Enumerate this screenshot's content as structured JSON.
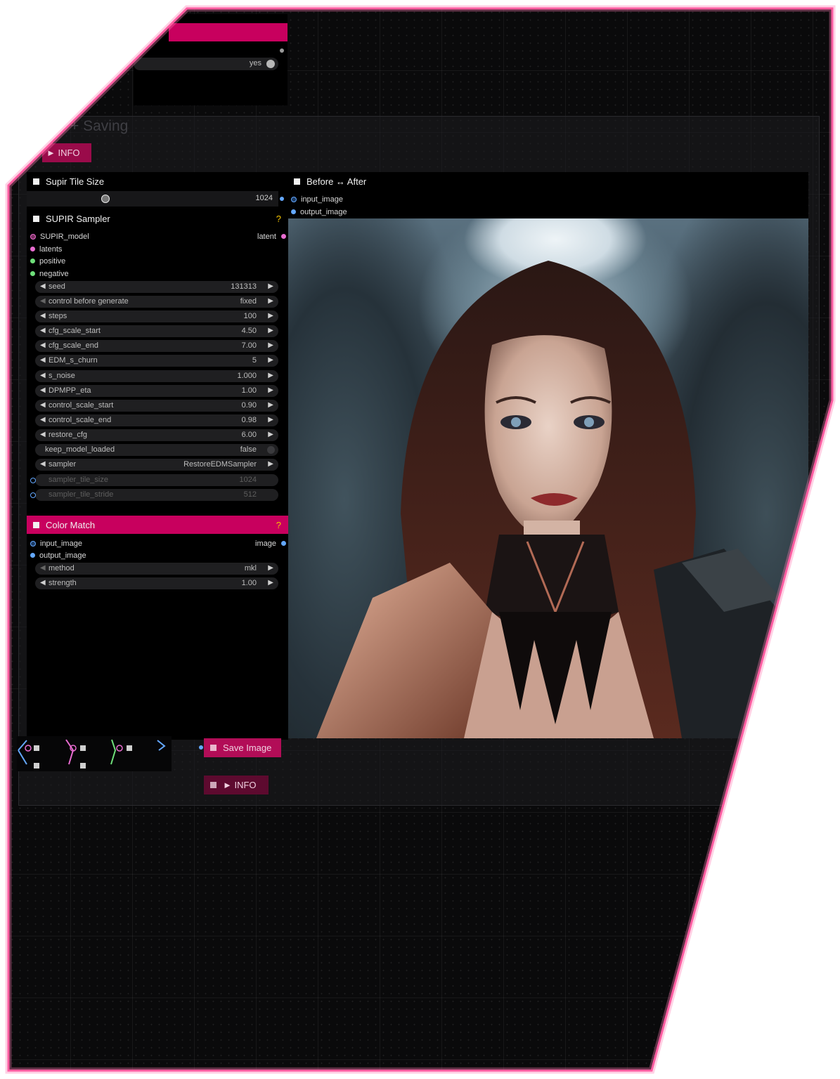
{
  "top_node": {
    "toggle_value": "yes"
  },
  "group": {
    "title": "+ Saving"
  },
  "info_top": {
    "label": "► INFO"
  },
  "supir_tile_size": {
    "title": "Supir Tile Size",
    "value": "1024"
  },
  "supir_sampler": {
    "title": "SUPIR Sampler",
    "help": "?",
    "inputs": [
      "SUPIR_model",
      "latents",
      "positive",
      "negative"
    ],
    "output": "latent",
    "widgets": [
      {
        "label": "seed",
        "value": "131313"
      },
      {
        "label": "control before generate",
        "value": "fixed"
      },
      {
        "label": "steps",
        "value": "100"
      },
      {
        "label": "cfg_scale_start",
        "value": "4.50"
      },
      {
        "label": "cfg_scale_end",
        "value": "7.00"
      },
      {
        "label": "EDM_s_churn",
        "value": "5"
      },
      {
        "label": "s_noise",
        "value": "1.000"
      },
      {
        "label": "DPMPP_eta",
        "value": "1.00"
      },
      {
        "label": "control_scale_start",
        "value": "0.90"
      },
      {
        "label": "control_scale_end",
        "value": "0.98"
      },
      {
        "label": "restore_cfg",
        "value": "6.00"
      },
      {
        "label": "keep_model_loaded",
        "value": "false"
      },
      {
        "label": "sampler",
        "value": "RestoreEDMSampler"
      },
      {
        "label": "sampler_tile_size",
        "value": "1024"
      },
      {
        "label": "sampler_tile_stride",
        "value": "512"
      }
    ]
  },
  "color_match": {
    "title": "Color Match",
    "help": "?",
    "inputs": [
      "input_image",
      "output_image"
    ],
    "output": "image",
    "widgets": [
      {
        "label": "method",
        "value": "mkl"
      },
      {
        "label": "strength",
        "value": "1.00"
      }
    ]
  },
  "before_after": {
    "title": "Before ↔ After",
    "inputs": [
      "input_image",
      "output_image"
    ]
  },
  "save_image": {
    "label": "Save Image"
  },
  "info_bottom": {
    "label": "► INFO"
  },
  "colors": {
    "accent": "#c8005e",
    "frame_glow": "#ff3c8c",
    "help": "#f5c400",
    "port_pink": "#e86cd0",
    "port_green": "#6fe07a",
    "port_blue": "#64a8ff"
  }
}
